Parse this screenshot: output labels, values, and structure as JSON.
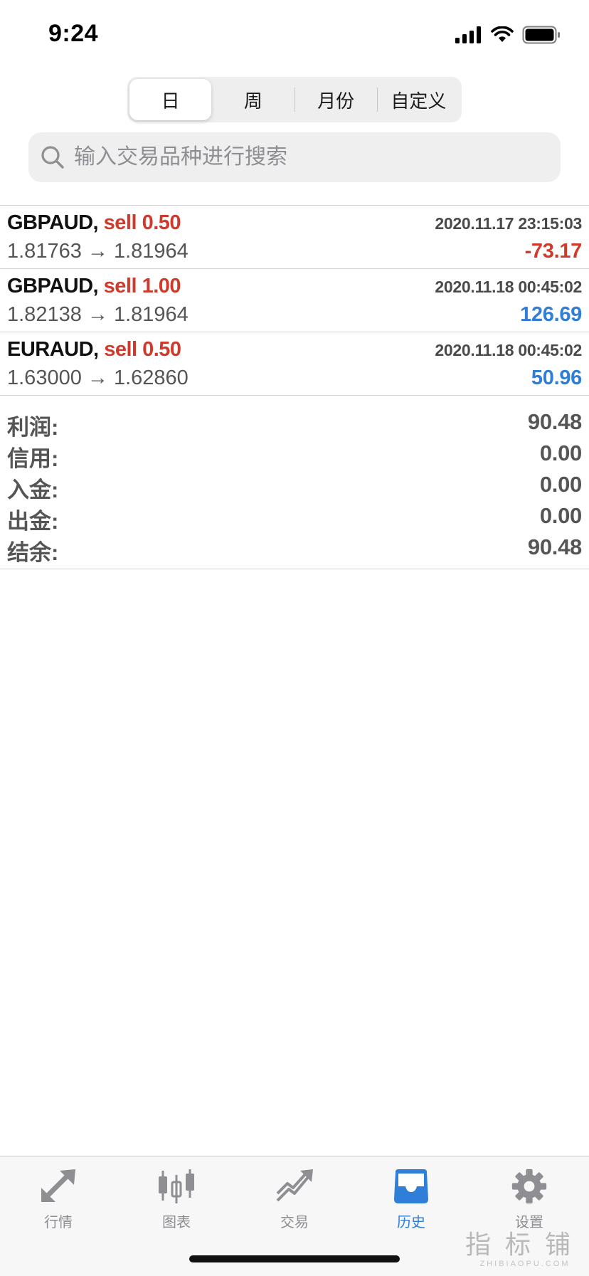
{
  "status_bar": {
    "time": "9:24"
  },
  "period_tabs": [
    {
      "label": "日",
      "selected": true
    },
    {
      "label": "周",
      "selected": false
    },
    {
      "label": "月份",
      "selected": false
    },
    {
      "label": "自定义",
      "selected": false
    }
  ],
  "search": {
    "placeholder": "输入交易品种进行搜索",
    "value": ""
  },
  "trades": [
    {
      "symbol": "GBPAUD,",
      "side": "sell 0.50",
      "time": "2020.11.17 23:15:03",
      "prices": "1.81763 → 1.81964",
      "profit": "-73.17",
      "profit_color": "#cf3a2c"
    },
    {
      "symbol": "GBPAUD,",
      "side": "sell 1.00",
      "time": "2020.11.18 00:45:02",
      "prices": "1.82138 → 1.81964",
      "profit": "126.69",
      "profit_color": "#2f7ed8"
    },
    {
      "symbol": "EURAUD,",
      "side": "sell 0.50",
      "time": "2020.11.18 00:45:02",
      "prices": "1.63000 → 1.62860",
      "profit": "50.96",
      "profit_color": "#2f7ed8"
    }
  ],
  "summary": [
    {
      "label": "利润:",
      "value": "90.48"
    },
    {
      "label": "信用:",
      "value": "0.00"
    },
    {
      "label": "入金:",
      "value": "0.00"
    },
    {
      "label": "出金:",
      "value": "0.00"
    },
    {
      "label": "结余:",
      "value": "90.48"
    }
  ],
  "tab_bar": [
    {
      "label": "行情",
      "icon": "quotes-arrows-icon",
      "active": false
    },
    {
      "label": "图表",
      "icon": "candlestick-chart-icon",
      "active": false
    },
    {
      "label": "交易",
      "icon": "trade-trend-icon",
      "active": false
    },
    {
      "label": "历史",
      "icon": "history-inbox-icon",
      "active": true
    },
    {
      "label": "设置",
      "icon": "gear-icon",
      "active": false
    }
  ],
  "watermark": {
    "main": "指标铺",
    "sub": "ZHIBIAOPU.COM"
  },
  "colors": {
    "sell": "#cf3a2c",
    "loss": "#cf3a2c",
    "gain": "#2f7ed8",
    "active_tab": "#2f7ed8",
    "inactive_tab": "#8e8e93"
  }
}
